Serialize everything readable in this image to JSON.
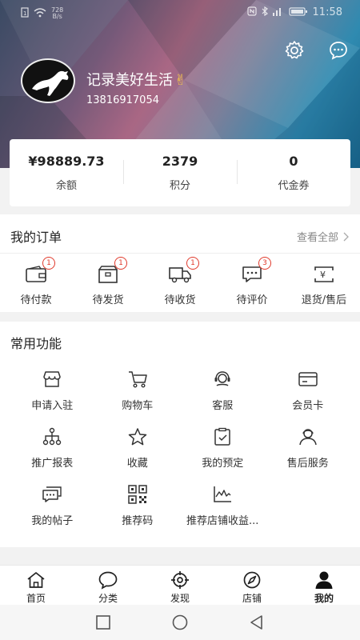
{
  "status_bar": {
    "speed_top": "728",
    "speed_unit": "B/s",
    "time": "11:58"
  },
  "profile": {
    "username": "记录美好生活",
    "emoji": "✌",
    "phone": "13816917054"
  },
  "stats": [
    {
      "value": "¥98889.73",
      "label": "余额"
    },
    {
      "value": "2379",
      "label": "积分"
    },
    {
      "value": "0",
      "label": "代金券"
    }
  ],
  "orders": {
    "title": "我的订单",
    "view_all": "查看全部",
    "items": [
      {
        "label": "待付款",
        "badge": "1",
        "icon": "wallet-icon"
      },
      {
        "label": "待发货",
        "badge": "1",
        "icon": "box-icon"
      },
      {
        "label": "待收货",
        "badge": "1",
        "icon": "truck-icon"
      },
      {
        "label": "待评价",
        "badge": "3",
        "icon": "comment-icon"
      },
      {
        "label": "退货/售后",
        "badge": "",
        "icon": "refund-icon"
      }
    ]
  },
  "functions": {
    "title": "常用功能",
    "items": [
      {
        "label": "申请入驻",
        "icon": "store-icon"
      },
      {
        "label": "购物车",
        "icon": "cart-icon"
      },
      {
        "label": "客服",
        "icon": "headset-icon"
      },
      {
        "label": "会员卡",
        "icon": "card-icon"
      },
      {
        "label": "推广报表",
        "icon": "hierarchy-icon"
      },
      {
        "label": "收藏",
        "icon": "star-icon"
      },
      {
        "label": "我的预定",
        "icon": "clipboard-check-icon"
      },
      {
        "label": "售后服务",
        "icon": "service-person-icon"
      },
      {
        "label": "我的帖子",
        "icon": "post-icon"
      },
      {
        "label": "推荐码",
        "icon": "qr-code-icon"
      },
      {
        "label": "推荐店铺收益...",
        "icon": "line-chart-icon"
      }
    ]
  },
  "tabs": [
    {
      "label": "首页",
      "icon": "home-icon"
    },
    {
      "label": "分类",
      "icon": "chat-bubble-icon"
    },
    {
      "label": "发现",
      "icon": "target-icon"
    },
    {
      "label": "店铺",
      "icon": "compass-icon"
    },
    {
      "label": "我的",
      "icon": "user-icon"
    }
  ],
  "colors": {
    "badge": "#e0392b",
    "text": "#222222",
    "muted": "#888888"
  }
}
